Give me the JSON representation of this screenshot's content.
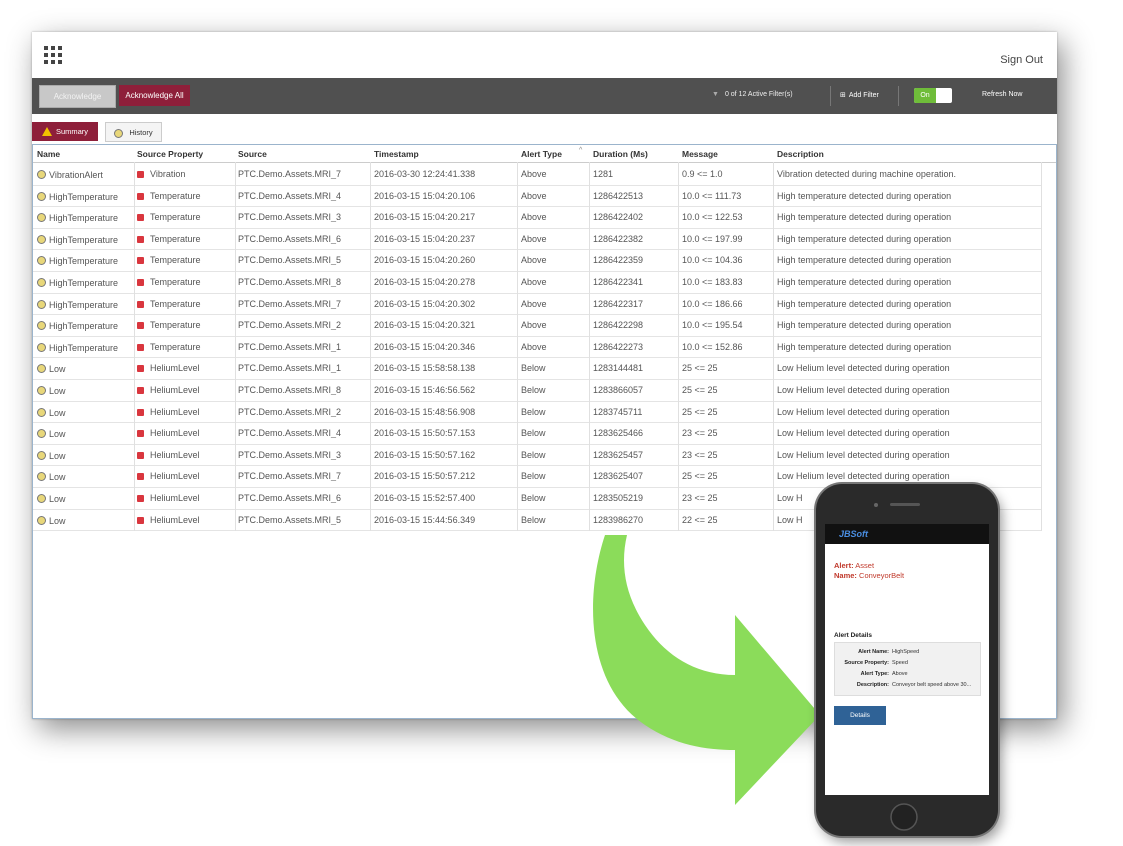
{
  "header": {
    "sign_out": "Sign Out"
  },
  "toolbar": {
    "acknowledge": "Acknowledge",
    "acknowledge_all": "Acknowledge All",
    "filter_status": "0 of 12 Active Filter(s)",
    "add_filter": "Add Filter",
    "toggle_label": "On",
    "refresh_now": "Refresh Now"
  },
  "tabs": {
    "summary": "Summary",
    "history": "History"
  },
  "table": {
    "columns": [
      "Name",
      "Source Property",
      "Source",
      "Timestamp",
      "Alert Type",
      "Duration (Ms)",
      "Message",
      "Description"
    ],
    "rows": [
      [
        "VibrationAlert",
        "Vibration",
        "PTC.Demo.Assets.MRI_7",
        "2016-03-30 12:24:41.338",
        "Above",
        "1281",
        "0.9 <= 1.0",
        "Vibration detected during machine operation."
      ],
      [
        "HighTemperature",
        "Temperature",
        "PTC.Demo.Assets.MRI_4",
        "2016-03-15 15:04:20.106",
        "Above",
        "1286422513",
        "10.0 <= 111.73",
        "High temperature detected during operation"
      ],
      [
        "HighTemperature",
        "Temperature",
        "PTC.Demo.Assets.MRI_3",
        "2016-03-15 15:04:20.217",
        "Above",
        "1286422402",
        "10.0 <= 122.53",
        "High temperature detected during operation"
      ],
      [
        "HighTemperature",
        "Temperature",
        "PTC.Demo.Assets.MRI_6",
        "2016-03-15 15:04:20.237",
        "Above",
        "1286422382",
        "10.0 <= 197.99",
        "High temperature detected during operation"
      ],
      [
        "HighTemperature",
        "Temperature",
        "PTC.Demo.Assets.MRI_5",
        "2016-03-15 15:04:20.260",
        "Above",
        "1286422359",
        "10.0 <= 104.36",
        "High temperature detected during operation"
      ],
      [
        "HighTemperature",
        "Temperature",
        "PTC.Demo.Assets.MRI_8",
        "2016-03-15 15:04:20.278",
        "Above",
        "1286422341",
        "10.0 <= 183.83",
        "High temperature detected during operation"
      ],
      [
        "HighTemperature",
        "Temperature",
        "PTC.Demo.Assets.MRI_7",
        "2016-03-15 15:04:20.302",
        "Above",
        "1286422317",
        "10.0 <= 186.66",
        "High temperature detected during operation"
      ],
      [
        "HighTemperature",
        "Temperature",
        "PTC.Demo.Assets.MRI_2",
        "2016-03-15 15:04:20.321",
        "Above",
        "1286422298",
        "10.0 <= 195.54",
        "High temperature detected during operation"
      ],
      [
        "HighTemperature",
        "Temperature",
        "PTC.Demo.Assets.MRI_1",
        "2016-03-15 15:04:20.346",
        "Above",
        "1286422273",
        "10.0 <= 152.86",
        "High temperature detected during operation"
      ],
      [
        "Low",
        "HeliumLevel",
        "PTC.Demo.Assets.MRI_1",
        "2016-03-15 15:58:58.138",
        "Below",
        "1283144481",
        "25 <= 25",
        "Low Helium level detected during operation"
      ],
      [
        "Low",
        "HeliumLevel",
        "PTC.Demo.Assets.MRI_8",
        "2016-03-15 15:46:56.562",
        "Below",
        "1283866057",
        "25 <= 25",
        "Low Helium level detected during operation"
      ],
      [
        "Low",
        "HeliumLevel",
        "PTC.Demo.Assets.MRI_2",
        "2016-03-15 15:48:56.908",
        "Below",
        "1283745711",
        "25 <= 25",
        "Low Helium level detected during operation"
      ],
      [
        "Low",
        "HeliumLevel",
        "PTC.Demo.Assets.MRI_4",
        "2016-03-15 15:50:57.153",
        "Below",
        "1283625466",
        "23 <= 25",
        "Low Helium level detected during operation"
      ],
      [
        "Low",
        "HeliumLevel",
        "PTC.Demo.Assets.MRI_3",
        "2016-03-15 15:50:57.162",
        "Below",
        "1283625457",
        "23 <= 25",
        "Low Helium level detected during operation"
      ],
      [
        "Low",
        "HeliumLevel",
        "PTC.Demo.Assets.MRI_7",
        "2016-03-15 15:50:57.212",
        "Below",
        "1283625407",
        "25 <= 25",
        "Low Helium level detected during operation"
      ],
      [
        "Low",
        "HeliumLevel",
        "PTC.Demo.Assets.MRI_6",
        "2016-03-15 15:52:57.400",
        "Below",
        "1283505219",
        "23 <= 25",
        "Low H"
      ],
      [
        "Low",
        "HeliumLevel",
        "PTC.Demo.Assets.MRI_5",
        "2016-03-15 15:44:56.349",
        "Below",
        "1283986270",
        "22 <= 25",
        "Low H"
      ]
    ]
  },
  "phone": {
    "brand": "JBSoft",
    "alert_label": "Alert:",
    "alert_value": "Asset",
    "name_label": "Name:",
    "name_value": "ConveyorBelt",
    "details_title": "Alert Details",
    "details": [
      {
        "key": "Alert Name:",
        "value": "HighSpeed"
      },
      {
        "key": "Source Property:",
        "value": "Speed"
      },
      {
        "key": "Alert Type:",
        "value": "Above"
      },
      {
        "key": "Description:",
        "value": "Conveyor belt speed above 30..."
      }
    ],
    "button": "Details"
  },
  "colors": {
    "accent": "#8e1f3a",
    "toolbar": "#505050",
    "toggle_on": "#6fbd3a",
    "arrow": "#8bdc5a",
    "button_blue": "#2f6296"
  }
}
